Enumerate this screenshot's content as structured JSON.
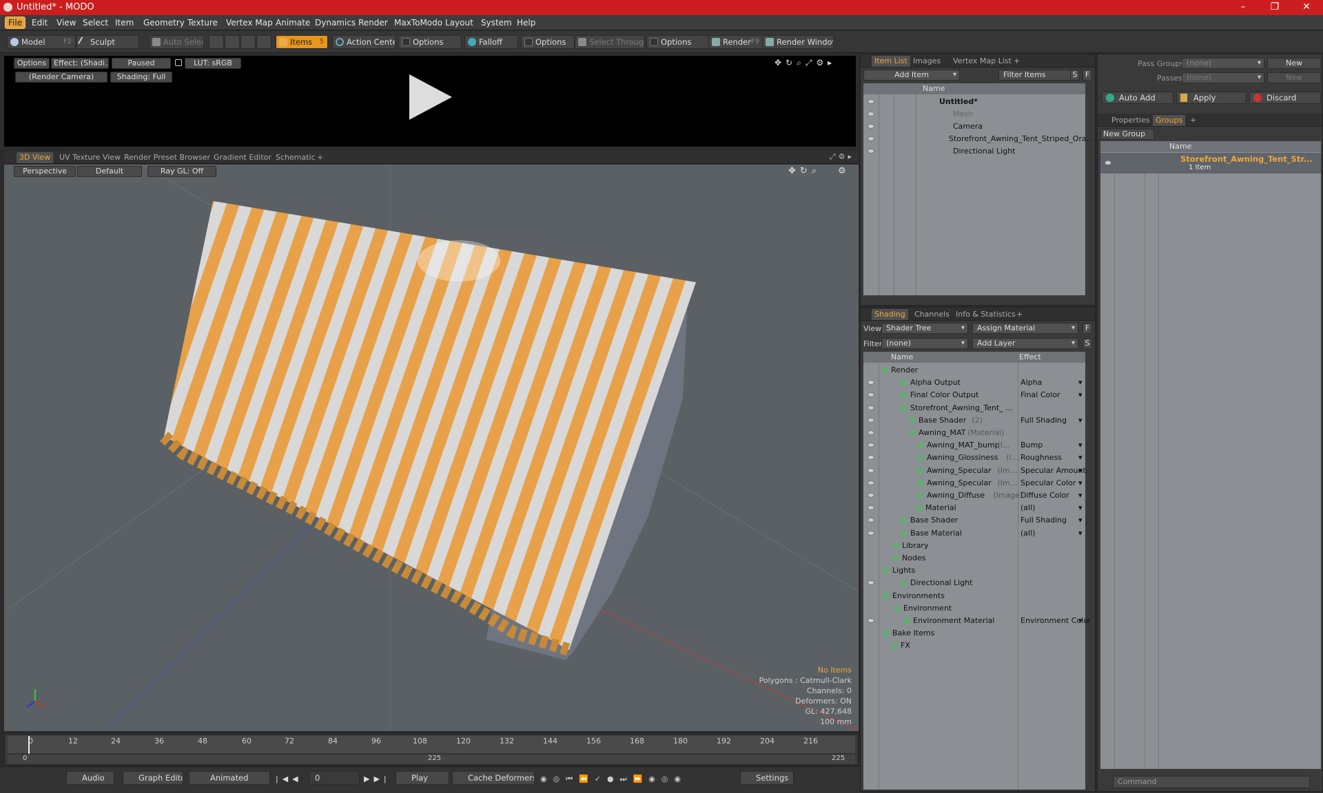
{
  "window": {
    "title": "Untitled* - MODO",
    "minimize": "–",
    "maximize": "❐",
    "close": "✕"
  },
  "menu": [
    "File",
    "Edit",
    "View",
    "Select",
    "Item",
    "Geometry",
    "Texture",
    "Vertex Map",
    "Animate",
    "Dynamics",
    "Render",
    "MaxToModo",
    "Layout",
    "System",
    "Help"
  ],
  "toolbar": {
    "model": "Model",
    "model_key": "F2",
    "sculpt": "Sculpt",
    "auto_select": "Auto Select",
    "items": "Items",
    "items_key": "5",
    "action_center": "Action Center",
    "options1": "Options",
    "falloff": "Falloff",
    "options2": "Options",
    "select_through": "Select Through",
    "options3": "Options",
    "render": "Render",
    "render_key": "F9",
    "render_window": "Render Window"
  },
  "preview": {
    "options": "Options",
    "effect": "Effect: (Shadi...",
    "paused": "Paused",
    "lut": "LUT: sRGB",
    "camera": "(Render Camera)",
    "shading": "Shading: Full"
  },
  "viewport_tabs": [
    "3D View",
    "UV Texture View",
    "Render Preset Browser",
    "Gradient Editor",
    "Schematic",
    "+"
  ],
  "viewport": {
    "perspective": "Perspective",
    "default": "Default",
    "raygl": "Ray GL: Off",
    "stats": [
      "No Items",
      "Polygons : Catmull-Clark",
      "Channels: 0",
      "Deformers: ON",
      "GL: 427,648",
      "100 mm"
    ],
    "stripe_color": "#e8a149",
    "stripe_alt": "#d8d8d8"
  },
  "timeline": {
    "ticks": [
      "0",
      "12",
      "24",
      "36",
      "48",
      "60",
      "72",
      "84",
      "96",
      "108",
      "120",
      "132",
      "144",
      "156",
      "168",
      "180",
      "192",
      "204",
      "216"
    ],
    "lower": [
      "0",
      "225",
      "225"
    ]
  },
  "bottombar": {
    "audio": "Audio",
    "graph_editor": "Graph Editor",
    "animated": "Animated",
    "frame": "0",
    "play": "Play",
    "cache": "Cache Deformers",
    "settings": "Settings"
  },
  "itemlist": {
    "tabs": [
      "Item List",
      "Images",
      "Vertex Map List",
      "+"
    ],
    "add_item": "Add Item",
    "filter_items": "Filter Items",
    "s": "S",
    "f": "F",
    "col_name": "Name",
    "rows": [
      "Untitled*",
      "Mesh",
      "Camera",
      "Storefront_Awning_Tent_Striped_Ora...",
      "Directional Light"
    ]
  },
  "shading": {
    "tabs": [
      "Shading",
      "Channels",
      "Info & Statistics",
      "+"
    ],
    "view_label": "View",
    "view_value": "Shader Tree",
    "assign": "Assign Material",
    "f": "F",
    "filter_label": "Filter",
    "filter_value": "(none)",
    "add_layer": "Add Layer",
    "s": "S",
    "col_name": "Name",
    "col_effect": "Effect",
    "rows": [
      {
        "name": "Render",
        "sub": "",
        "effect": ""
      },
      {
        "name": "Alpha Output",
        "sub": "",
        "effect": "Alpha"
      },
      {
        "name": "Final Color Output",
        "sub": "",
        "effect": "Final Color"
      },
      {
        "name": "Storefront_Awning_Tent_ ...",
        "sub": "",
        "effect": ""
      },
      {
        "name": "Base Shader",
        "sub": "(2)",
        "effect": "Full Shading"
      },
      {
        "name": "Awning_MAT",
        "sub": "(Material)",
        "effect": ""
      },
      {
        "name": "Awning_MAT_bump",
        "sub": "(I...",
        "effect": "Bump"
      },
      {
        "name": "Awning_Glossiness",
        "sub": "(I...",
        "effect": "Roughness"
      },
      {
        "name": "Awning_Specular",
        "sub": "(Im...",
        "effect": "Specular Amount"
      },
      {
        "name": "Awning_Specular",
        "sub": "(Im...",
        "effect": "Specular Color"
      },
      {
        "name": "Awning_Diffuse",
        "sub": "(Image)",
        "effect": "Diffuse Color"
      },
      {
        "name": "Material",
        "sub": "",
        "effect": "(all)"
      },
      {
        "name": "Base Shader",
        "sub": "",
        "effect": "Full Shading"
      },
      {
        "name": "Base Material",
        "sub": "",
        "effect": "(all)"
      },
      {
        "name": "Library",
        "sub": "",
        "effect": ""
      },
      {
        "name": "Nodes",
        "sub": "",
        "effect": ""
      },
      {
        "name": "Lights",
        "sub": "",
        "effect": ""
      },
      {
        "name": "Directional Light",
        "sub": "",
        "effect": ""
      },
      {
        "name": "Environments",
        "sub": "",
        "effect": ""
      },
      {
        "name": "Environment",
        "sub": "",
        "effect": ""
      },
      {
        "name": "Environment Material",
        "sub": "",
        "effect": "Environment Color"
      },
      {
        "name": "Bake Items",
        "sub": "",
        "effect": ""
      },
      {
        "name": "FX",
        "sub": "",
        "effect": ""
      }
    ]
  },
  "groups": {
    "pass_groups": "Pass Groups",
    "pass_groups_val": "(none)",
    "new": "New",
    "passes": "Passes",
    "passes_val": "(none)",
    "new2": "New",
    "auto_add": "Auto Add",
    "apply": "Apply",
    "discard": "Discard",
    "tabs": [
      "Properties",
      "Groups",
      "+"
    ],
    "new_group": "New Group",
    "col_name": "Name",
    "item_name": "Storefront_Awning_Tent_Str...",
    "item_count": "1 Item",
    "command": "Command"
  }
}
